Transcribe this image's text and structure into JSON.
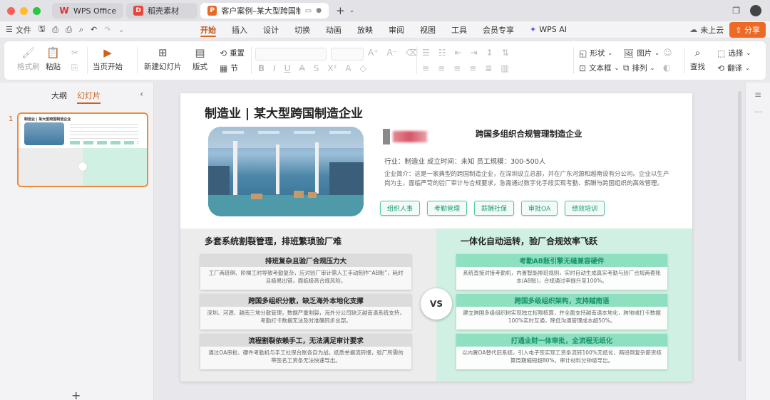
{
  "titlebar": {
    "tabs": [
      {
        "label": "WPS Office",
        "icon": "wps-logo-icon"
      },
      {
        "label": "稻壳素材",
        "icon": "docer-icon"
      },
      {
        "label": "客户案例–某大型跨国制造",
        "icon": "ppt-icon"
      }
    ],
    "new_tab": "+",
    "colors": {
      "close": "#ff5f57",
      "minimize": "#febc2e",
      "maximize": "#28c840"
    }
  },
  "menubar": {
    "file_label": "文件",
    "tabs": [
      "开始",
      "插入",
      "设计",
      "切换",
      "动画",
      "放映",
      "审阅",
      "视图",
      "工具",
      "会员专享",
      "WPS AI"
    ],
    "active_tab": "开始",
    "cloud_label": "未上云",
    "share_label": "分享"
  },
  "ribbon": {
    "format_painter": "格式刷",
    "paste": "粘贴",
    "play_from_current": "当页开始",
    "new_slide": "新建幻灯片",
    "layout": "版式",
    "reset": "重置",
    "section": "节",
    "shape": "形状",
    "picture": "图片",
    "textbox": "文本框",
    "arrange": "排列",
    "find": "查找",
    "select": "选择",
    "translate": "翻译"
  },
  "left_panel": {
    "tabs": [
      "大纲",
      "幻灯片"
    ],
    "active_tab": "幻灯片",
    "slide_number": "1",
    "thumb_title": "制造业 | 某大型跨国制造企业"
  },
  "slide": {
    "title": "制造业 | 某大型跨国制造企业",
    "company": "跨国多组织合规管理制造企业",
    "meta": "行业：制造业  成立时间：未知  员工规模：300-500人",
    "intro": "企业简介：这是一家典型的跨国制造企业，在深圳设立总部，并在广东河源和越南设有分公司。企业以生产岗为主，面临严苛的验厂审计与合规要求，急需通过数字化手段实现考勤、薪酬与跨国组织的高效管理。",
    "tags": [
      "组织人事",
      "考勤管理",
      "薪酬社保",
      "审批OA",
      "绩效培训"
    ],
    "vs": "VS",
    "left": {
      "heading": "多套系统割裂管理，排班繁琐验厂难",
      "cards": [
        {
          "title": "排班复杂且验厂合规压力大",
          "body": "工厂两班倒、阶梯工时导致考勤复杂，应对验厂审计需人工手动制作“AB账”，耗时且极易出错，面临极高合规风险。"
        },
        {
          "title": "跨国多组织分散，缺乏海外本地化支撑",
          "body": "深圳、河源、越南三地分散管理，数据严重割裂，海外分公司缺乏越南语系统支持，考勤打卡数据无法及时准确同步总部。"
        },
        {
          "title": "流程割裂依赖手工，无法满足审计要求",
          "body": "通过OA审批、硬件考勤机与手工社保台账各自为战，纸质单据流转慢，验厂所需的带签名工资条无法快速导出。"
        }
      ]
    },
    "right": {
      "heading": "一体化自动运转，验厂合规效率飞跃",
      "cards": [
        {
          "title": "考勤AB账引擎无缝兼容硬件",
          "body": "系统直接对接考勤机，内置智能排班规则，实时自动生成真实考勤与验厂合规两套账本(AB账)，合规通过率提升至100%。"
        },
        {
          "title": "跨国多级组织架构，支持越南语",
          "body": "建立跨国多级组织树实现独立权限核算，并全面支持越南语本地化，跨地域打卡数据100%实时互通，降低沟通管理成本超50%。"
        },
        {
          "title": "打通业财一体审批，全流程无纸化",
          "body": "以内置OA替代旧系统，引入电子签实现工资条流转100%无纸化，两班倒复杂薪资核算周期缩短超80%，审计材料分钟级导出。"
        }
      ]
    }
  }
}
